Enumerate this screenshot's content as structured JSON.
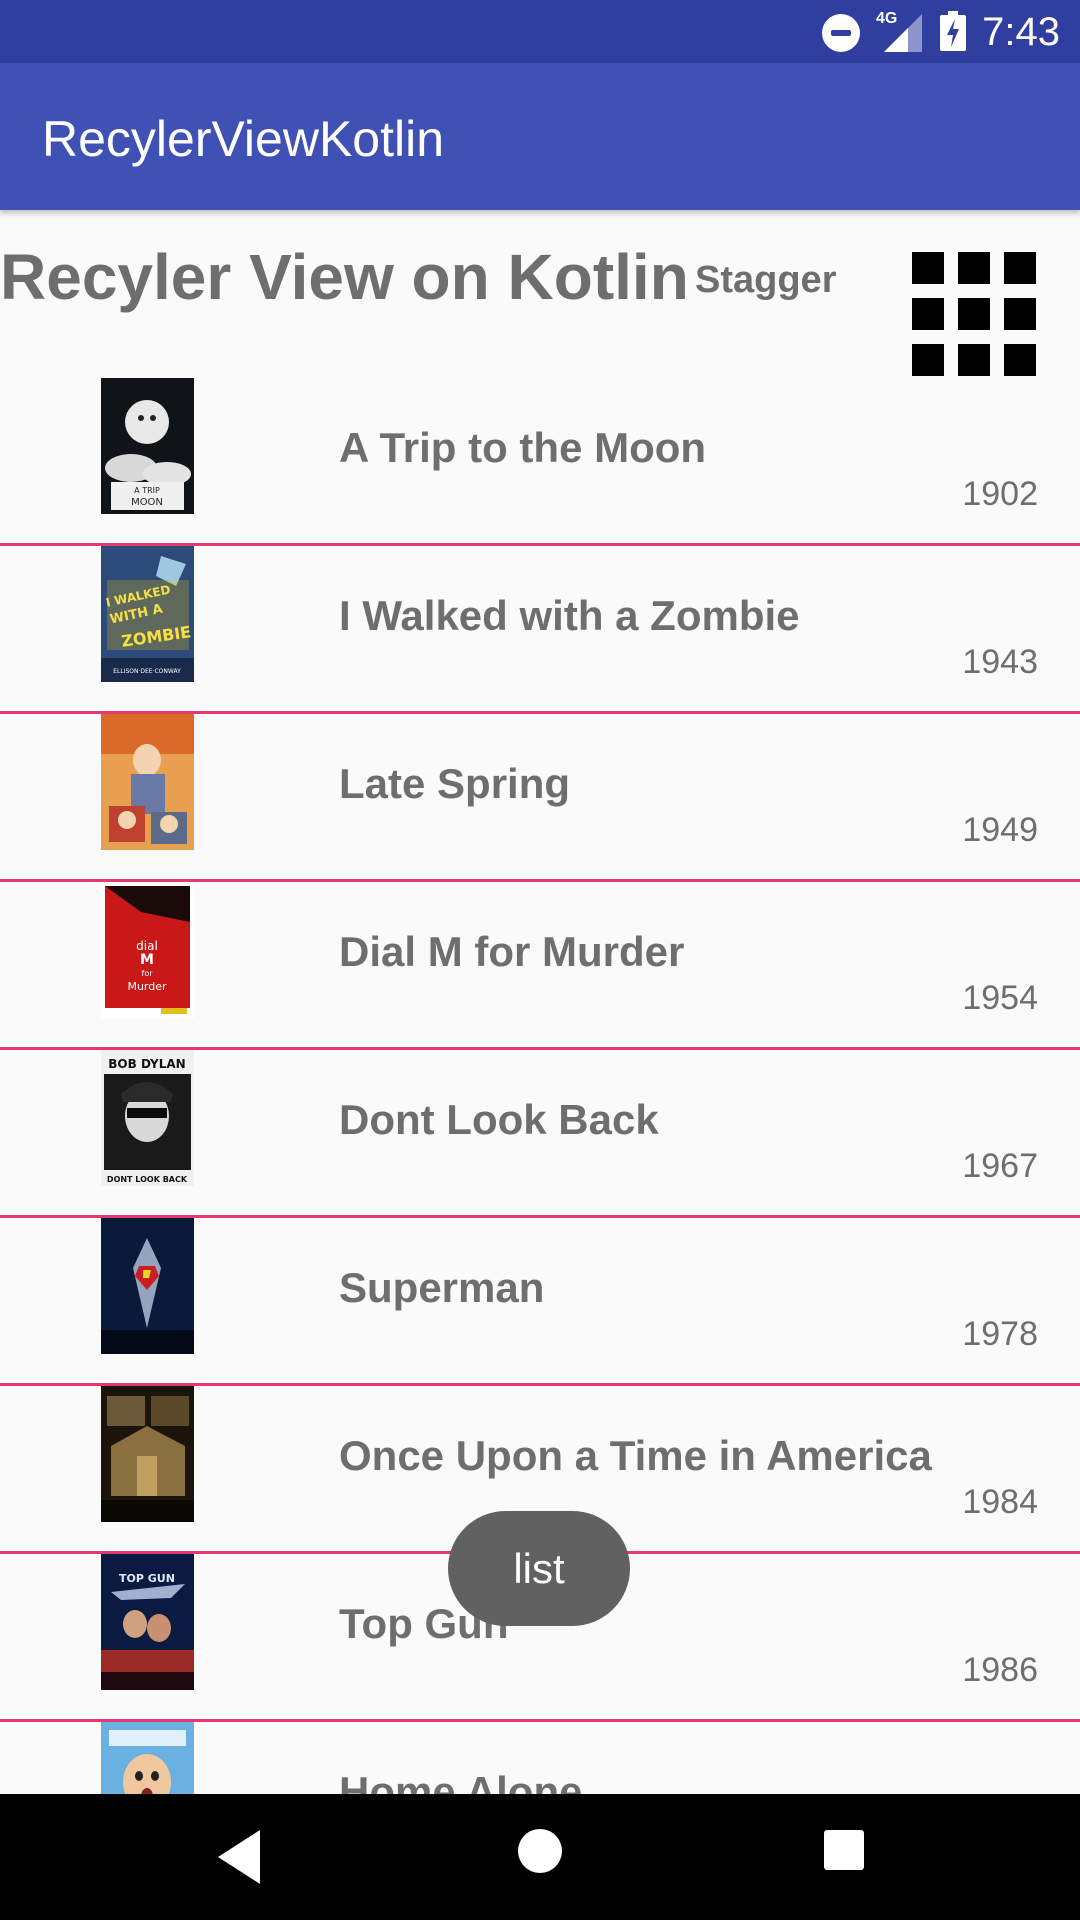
{
  "status_bar": {
    "network_label": "4G",
    "time": "7:43"
  },
  "app_bar": {
    "title": "RecylerViewKotlin"
  },
  "header": {
    "title": "Recyler View on Kotlin",
    "layout_label": "Stagger",
    "layout_icon": "grid-icon"
  },
  "movies": [
    {
      "title": "A Trip to the Moon",
      "year": "1902",
      "poster_lines": [
        "A TRIP",
        "MOON"
      ]
    },
    {
      "title": "I Walked with a Zombie",
      "year": "1943",
      "poster_lines": [
        "I WALKED",
        "WITH A",
        "ZOMBIE",
        "ELLISON·DEE·CONWAY"
      ]
    },
    {
      "title": "Late Spring",
      "year": "1949",
      "poster_lines": []
    },
    {
      "title": "Dial M for Murder",
      "year": "1954",
      "poster_lines": [
        "dial",
        "M",
        "for",
        "Murder"
      ]
    },
    {
      "title": "Dont Look Back",
      "year": "1967",
      "poster_lines": [
        "BOB DYLAN",
        "DONT LOOK BACK"
      ]
    },
    {
      "title": "Superman",
      "year": "1978",
      "poster_lines": []
    },
    {
      "title": "Once Upon a Time in America",
      "year": "1984",
      "poster_lines": []
    },
    {
      "title": "Top Gun",
      "year": "1986",
      "poster_lines": [
        "TOP GUN"
      ]
    },
    {
      "title": "Home Alone",
      "year": "",
      "poster_lines": []
    }
  ],
  "toast": {
    "text": "list"
  },
  "colors": {
    "status_bar": "#303f9f",
    "app_bar": "#3f51b5",
    "divider": "#e53a6f",
    "text": "#6e6e6e"
  },
  "nav_bar": {
    "back_icon": "back-triangle-icon",
    "home_icon": "home-circle-icon",
    "recents_icon": "recents-square-icon"
  }
}
